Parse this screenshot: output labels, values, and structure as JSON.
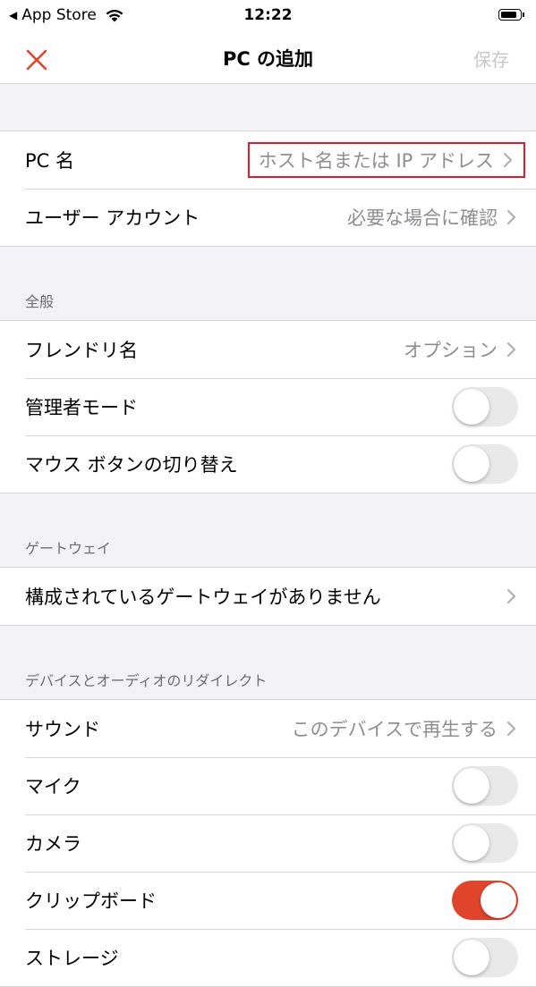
{
  "status_bar": {
    "back_label": "App Store",
    "time": "12:22"
  },
  "nav": {
    "title": "PC の追加",
    "save_label": "保存"
  },
  "connection": {
    "pc_name_label": "PC 名",
    "pc_name_placeholder": "ホスト名または IP アドレス",
    "user_account_label": "ユーザー アカウント",
    "user_account_value": "必要な場合に確認"
  },
  "general": {
    "header": "全般",
    "friendly_name_label": "フレンドリ名",
    "friendly_name_value": "オプション",
    "admin_mode_label": "管理者モード",
    "admin_mode_on": false,
    "swap_mouse_label": "マウス ボタンの切り替え",
    "swap_mouse_on": false
  },
  "gateway": {
    "header": "ゲートウェイ",
    "none_label": "構成されているゲートウェイがありません"
  },
  "redirect": {
    "header": "デバイスとオーディオのリダイレクト",
    "sound_label": "サウンド",
    "sound_value": "このデバイスで再生する",
    "mic_label": "マイク",
    "mic_on": false,
    "camera_label": "カメラ",
    "camera_on": false,
    "clipboard_label": "クリップボード",
    "clipboard_on": true,
    "storage_label": "ストレージ",
    "storage_on": false
  },
  "colors": {
    "accent": "#e0452b",
    "close_icon": "#e0452b",
    "highlight_border": "#e21b2a",
    "secondary_text": "#8e8e93",
    "disabled_text": "#c7c7cc"
  }
}
